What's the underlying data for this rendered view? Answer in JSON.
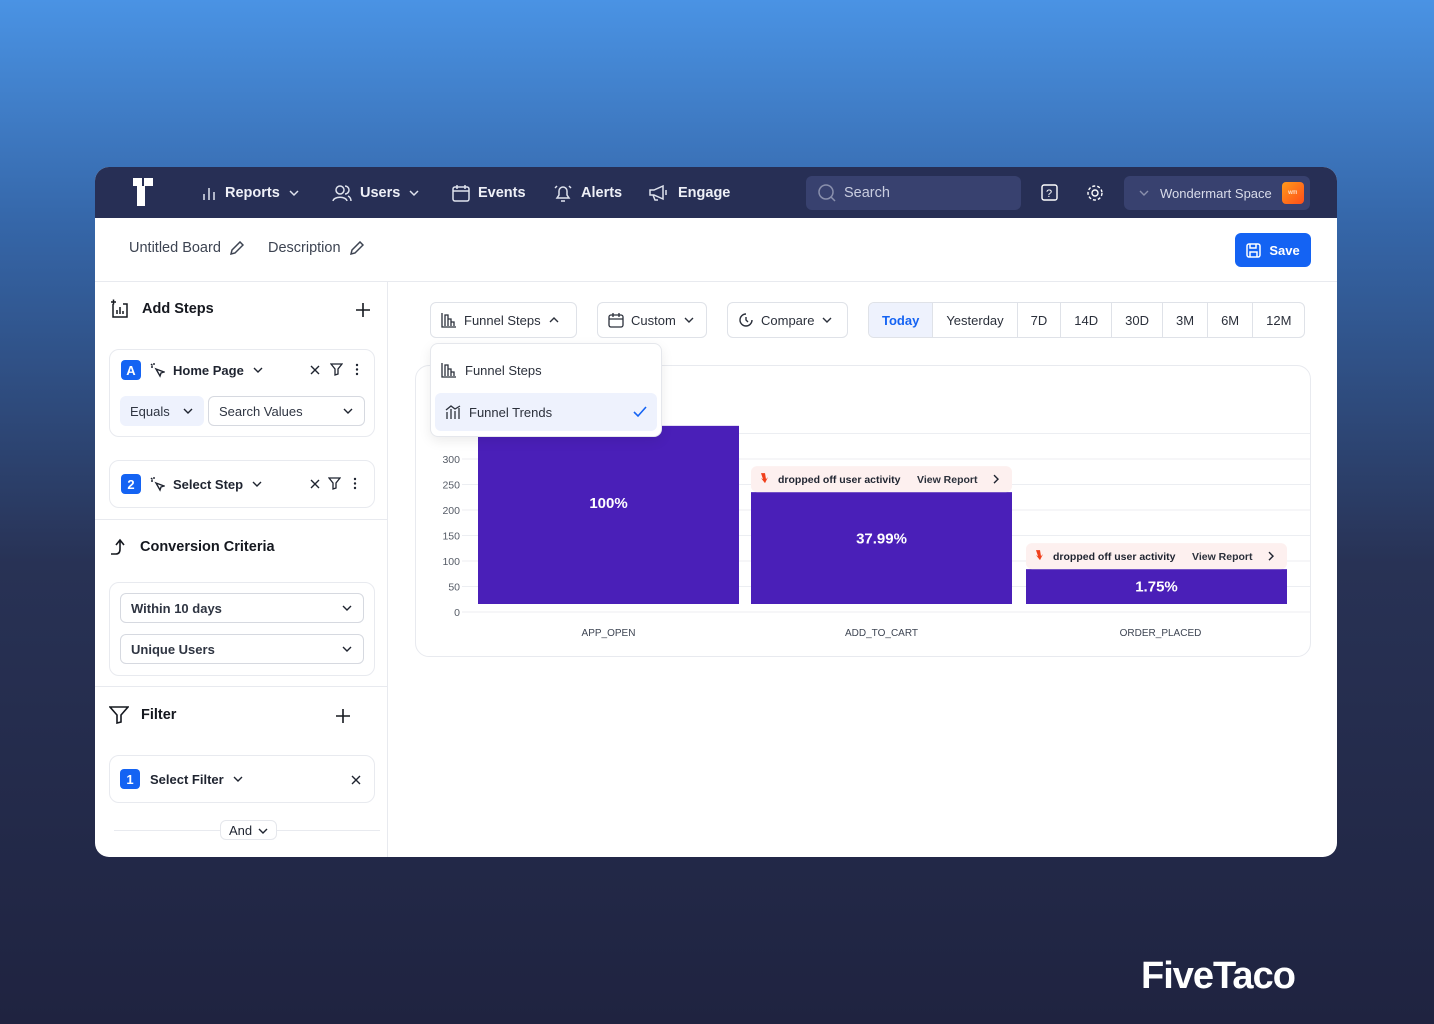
{
  "nav": {
    "items": [
      {
        "label": "Reports",
        "icon": "bar-chart-icon",
        "dropdown": true
      },
      {
        "label": "Users",
        "icon": "users-icon",
        "dropdown": true
      },
      {
        "label": "Events",
        "icon": "calendar-icon"
      },
      {
        "label": "Alerts",
        "icon": "bell-icon"
      },
      {
        "label": "Engage",
        "icon": "megaphone-icon"
      }
    ],
    "search_placeholder": "Search",
    "workspace": "Wondermart Space",
    "workspace_logo": "wonder mart"
  },
  "board": {
    "title": "Untitled Board",
    "description": "Description",
    "save_label": "Save"
  },
  "sidebar": {
    "add_steps": "Add Steps",
    "steps": [
      {
        "badge": "A",
        "label": "Home Page",
        "operator": "Equals",
        "value_placeholder": "Search Values"
      },
      {
        "badge": "2",
        "label": "Select Step"
      }
    ],
    "conversion": {
      "title": "Conversion Criteria",
      "window": "Within 10 days",
      "count": "Unique Users"
    },
    "filter": {
      "title": "Filter",
      "items": [
        {
          "badge": "1",
          "label": "Select Filter"
        }
      ],
      "joiner": "And"
    }
  },
  "toolbar": {
    "chart_type": "Funnel Steps",
    "date": "Custom",
    "compare": "Compare",
    "ranges": [
      "Today",
      "Yesterday",
      "7D",
      "14D",
      "30D",
      "3M",
      "6M",
      "12M"
    ],
    "active_range": "Today"
  },
  "dropdown": {
    "options": [
      {
        "label": "Funnel Steps",
        "selected": false
      },
      {
        "label": "Funnel Trends",
        "selected": true
      }
    ]
  },
  "colors": {
    "accent": "#1463f3",
    "bar": "#4a1fb8",
    "nav": "#272f55",
    "dropoff": "#f0401c"
  },
  "chart_data": {
    "type": "bar",
    "categories": [
      "APP_OPEN",
      "ADD_TO_CART",
      "ORDER_PLACED"
    ],
    "values": [
      365,
      235,
      84
    ],
    "labels": [
      "100%",
      "37.99%",
      "1.75%"
    ],
    "yticks": [
      0,
      50,
      100,
      150,
      200,
      250,
      300
    ],
    "ylim": [
      0,
      400
    ],
    "grid": true,
    "dropoff": {
      "text": "dropped off user activity",
      "link": "View Report"
    }
  },
  "footer_brand": "FiveTaco"
}
